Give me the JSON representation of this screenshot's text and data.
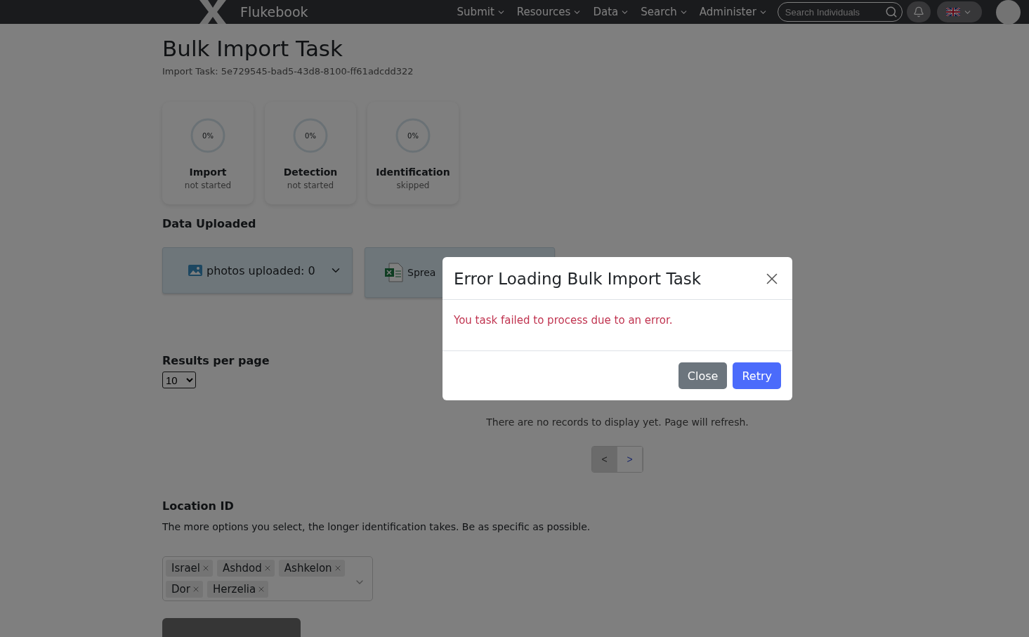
{
  "navbar": {
    "brand": "Flukebook",
    "menu": [
      {
        "label": "Submit"
      },
      {
        "label": "Resources"
      },
      {
        "label": "Data"
      },
      {
        "label": "Search"
      },
      {
        "label": "Administer"
      }
    ],
    "search": {
      "placeholder": "Search Individuals"
    }
  },
  "page": {
    "title": "Bulk Import Task",
    "subtitle": "Import Task: 5e729545-bad5-43d8-8100-ff61adcdd322",
    "stages": [
      {
        "name": "Import",
        "status": "not started",
        "percent": "0%"
      },
      {
        "name": "Detection",
        "status": "not started",
        "percent": "0%"
      },
      {
        "name": "Identification",
        "status": "skipped",
        "percent": "0%"
      }
    ],
    "data_uploaded": {
      "heading": "Data Uploaded",
      "cards": [
        {
          "kind": "photos",
          "label": "photos uploaded: 0"
        },
        {
          "kind": "spreadsheet",
          "label": "Sprea"
        }
      ]
    },
    "results_per_page": {
      "label": "Results per page",
      "value": "10"
    },
    "table": {
      "empty_message": "There are no records to display yet. Page will refresh.",
      "pagination": [
        {
          "label": "<",
          "disabled": true
        },
        {
          "label": ">",
          "disabled": false
        }
      ]
    },
    "location": {
      "heading": "Location ID",
      "hint": "The more options you select, the longer identification takes. Be as specific as possible.",
      "tags": [
        {
          "label": "Israel"
        },
        {
          "label": "Ashdod"
        },
        {
          "label": "Ashkelon"
        },
        {
          "label": "Dor"
        },
        {
          "label": "Herzelia"
        }
      ]
    }
  },
  "modal": {
    "title": "Error Loading Bulk Import Task",
    "message": "You task failed to process due to an error.",
    "buttons": [
      {
        "label": "Close",
        "kind": "secondary"
      },
      {
        "label": "Retry",
        "kind": "primary"
      }
    ]
  }
}
